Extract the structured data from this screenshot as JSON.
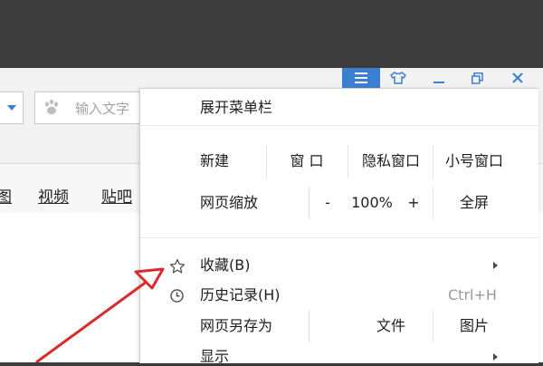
{
  "window_controls": {
    "menu_icon": "hamburger-menu-icon",
    "skin_icon": "tshirt-skin-icon",
    "minimize_icon": "minimize-icon",
    "restore_icon": "restore-window-icon",
    "close_icon": "close-icon"
  },
  "search": {
    "placeholder": "输入文字",
    "engine_icon": "paw-icon"
  },
  "favorites_bar": {
    "items": [
      "图",
      "视频",
      "贴吧"
    ]
  },
  "menu": {
    "expand_menubar": "展开菜单栏",
    "new_label": "新建",
    "new_window": "窗 口",
    "new_private_window": "隐私窗口",
    "new_small_window": "小号窗口",
    "zoom_label": "网页缩放",
    "zoom_out": "-",
    "zoom_value": "100%",
    "zoom_in": "+",
    "fullscreen": "全屏",
    "favorites": "收藏(B)",
    "history": "历史记录(H)",
    "history_shortcut": "Ctrl+H",
    "save_as": "网页另存为",
    "save_as_file": "文件",
    "save_as_image": "图片",
    "display": "显示"
  },
  "colors": {
    "accent": "#3b7fd2",
    "annotation_arrow": "#d92b2b",
    "window_bg": "#3c3c3c",
    "menu_bg": "#ffffff"
  }
}
